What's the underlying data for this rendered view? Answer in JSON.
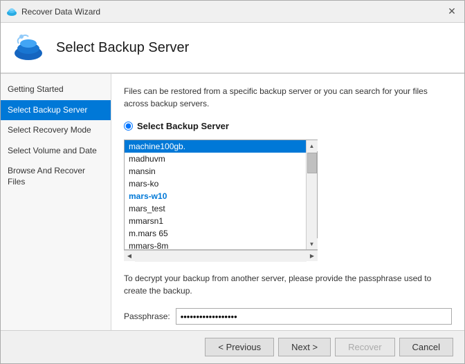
{
  "window": {
    "title": "Recover Data Wizard",
    "close_label": "✕"
  },
  "header": {
    "title": "Select Backup Server"
  },
  "sidebar": {
    "items": [
      {
        "id": "getting-started",
        "label": "Getting Started",
        "active": false
      },
      {
        "id": "select-backup-server",
        "label": "Select Backup Server",
        "active": true
      },
      {
        "id": "select-recovery-mode",
        "label": "Select Recovery Mode",
        "active": false
      },
      {
        "id": "select-volume-and-date",
        "label": "Select Volume and Date",
        "active": false
      },
      {
        "id": "browse-and-recover",
        "label": "Browse And Recover Files",
        "active": false
      }
    ]
  },
  "main": {
    "description": "Files can be restored from a specific backup server or you can search for your files across backup servers.",
    "radio_label": "Select Backup Server",
    "servers": [
      {
        "id": "machine100gb",
        "label": "machine100gb.",
        "selected": true
      },
      {
        "id": "madhuvm",
        "label": "madhuvm",
        "selected": false
      },
      {
        "id": "mansin",
        "label": "mansin",
        "selected": false
      },
      {
        "id": "mars-ko",
        "label": "mars-ko",
        "selected": false
      },
      {
        "id": "mars-w10",
        "label": "mars-w10",
        "selected": false
      },
      {
        "id": "mars_test",
        "label": "mars_test",
        "selected": false
      },
      {
        "id": "mmarsn1",
        "label": "mmarsn1",
        "selected": false
      },
      {
        "id": "m.mars65",
        "label": "m.mars 65",
        "selected": false
      },
      {
        "id": "mmars-8m",
        "label": "mmars-8m",
        "selected": false
      }
    ],
    "decrypt_text": "To decrypt your backup from another server, please provide the passphrase used to create the backup.",
    "passphrase_label": "Passphrase:",
    "passphrase_value": "••••••••••••••••••"
  },
  "footer": {
    "previous_label": "< Previous",
    "next_label": "Next >",
    "recover_label": "Recover",
    "cancel_label": "Cancel"
  }
}
